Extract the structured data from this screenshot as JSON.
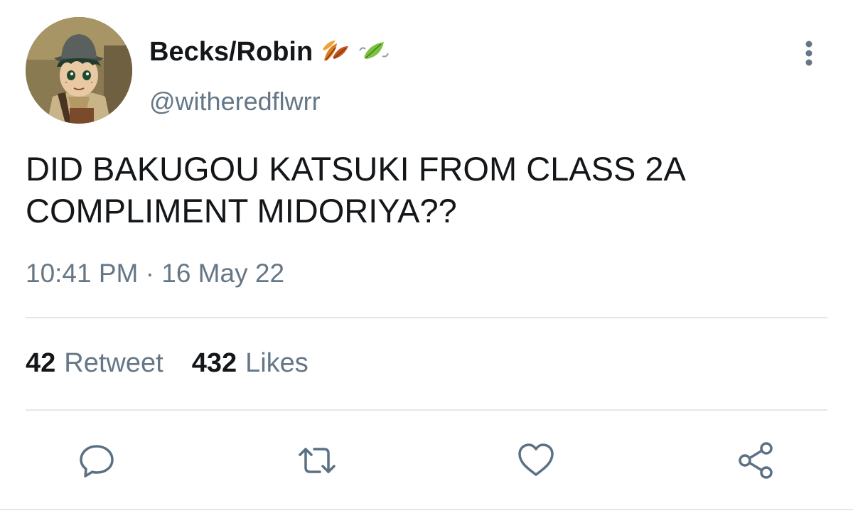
{
  "tweet": {
    "display_name": "Becks/Robin",
    "name_emoji": [
      "fallen-leaf-icon",
      "leaf-fluttering-icon"
    ],
    "handle": "@witheredflwrr",
    "text": "DID BAKUGOU KATSUKI FROM CLASS 2A COMPLIMENT MIDORIYA??",
    "timestamp": "10:41 PM · 16 May 22",
    "stats": {
      "retweet_count": "42",
      "retweet_label": "Retweet",
      "like_count": "432",
      "like_label": "Likes"
    }
  },
  "actions": [
    "reply-icon",
    "retweet-icon",
    "like-icon",
    "share-icon"
  ],
  "colors": {
    "text_primary": "#14171a",
    "text_secondary": "#657786",
    "divider": "#e1e8ed",
    "icon": "#5b7083"
  }
}
